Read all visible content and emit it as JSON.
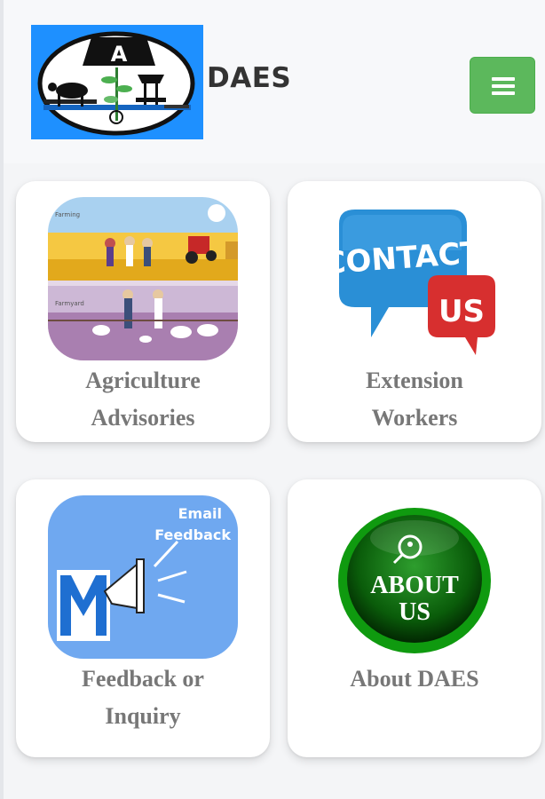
{
  "header": {
    "brand": "DAES",
    "logo_text": "A"
  },
  "cards": [
    {
      "label": "Agriculture Advisories",
      "line1": "Agriculture",
      "line2": "Advisories",
      "img_top_caption": "Farming",
      "img_bottom_caption": "Farmyard"
    },
    {
      "label": "Extension Workers",
      "line1": "Extension",
      "line2": "Workers",
      "img_text1": "CONTACT",
      "img_text2": "US"
    },
    {
      "label": "Feedback or Inquiry",
      "line1": "Feedback or",
      "line2": "Inquiry",
      "img_text1": "Email",
      "img_text2": "Feedback"
    },
    {
      "label": "About DAES",
      "line1": "About DAES",
      "img_text1": "ABOUT",
      "img_text2": "US"
    }
  ],
  "colors": {
    "menu_button": "#5cb85c",
    "logo_bg": "#1e90ff",
    "label": "#777777"
  },
  "icons": {
    "menu": "hamburger-icon"
  }
}
